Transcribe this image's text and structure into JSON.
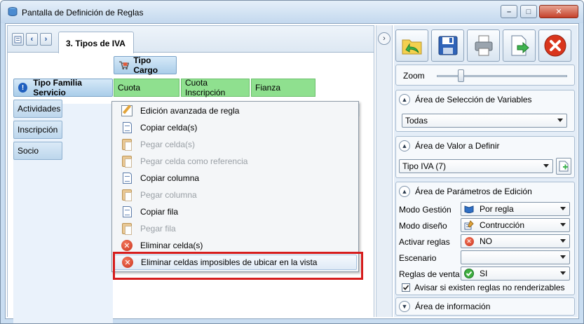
{
  "window": {
    "title": "Pantalla de Definición de Reglas",
    "controls": {
      "minimize": "–",
      "maximize": "□",
      "close": "✕"
    }
  },
  "tabs": {
    "active_label": "3. Tipos de IVA"
  },
  "grid": {
    "column_group_header": "Tipo Cargo",
    "row_group_header": "Tipo Familia Servicio",
    "columns": [
      "Cuota",
      "Cuota Inscripción",
      "Fianza"
    ],
    "rows": [
      "Actividades",
      "Inscripción",
      "Socio"
    ]
  },
  "context_menu": {
    "items": [
      {
        "label": "Edición avanzada de regla",
        "icon": "edit-icon",
        "enabled": true
      },
      {
        "label": "Copiar celda(s)",
        "icon": "copy-icon",
        "enabled": true
      },
      {
        "label": "Pegar celda(s)",
        "icon": "paste-icon",
        "enabled": false
      },
      {
        "label": "Pegar celda como referencia",
        "icon": "paste-icon",
        "enabled": false
      },
      {
        "label": "Copiar columna",
        "icon": "copy-icon",
        "enabled": true
      },
      {
        "label": "Pegar columna",
        "icon": "paste-icon",
        "enabled": false
      },
      {
        "label": "Copiar fila",
        "icon": "copy-icon",
        "enabled": true
      },
      {
        "label": "Pegar fila",
        "icon": "paste-icon",
        "enabled": false
      },
      {
        "label": "Eliminar celda(s)",
        "icon": "delete-icon",
        "enabled": true
      },
      {
        "label": "Eliminar celdas imposibles de ubicar en la vista",
        "icon": "delete-icon",
        "enabled": true,
        "highlighted": true
      }
    ]
  },
  "toolbar": {
    "buttons": [
      "open-folder-icon",
      "save-icon",
      "print-icon",
      "export-icon",
      "close-red-icon"
    ]
  },
  "zoom": {
    "label": "Zoom",
    "level": 0.19
  },
  "variables_section": {
    "title": "Área de Selección de Variables",
    "value": "Todas"
  },
  "value_section": {
    "title": "Área de Valor a Definir",
    "value": "Tipo IVA (7)"
  },
  "params_section": {
    "title": "Área de Parámetros de Edición",
    "rows": [
      {
        "label": "Modo Gestión",
        "value": "Por regla",
        "icon": "book-icon"
      },
      {
        "label": "Modo diseño",
        "value": "Contrucción",
        "icon": "design-icon"
      },
      {
        "label": "Activar reglas",
        "value": "NO",
        "icon": "no-icon"
      },
      {
        "label": "Escenario",
        "value": "",
        "icon": ""
      },
      {
        "label": "Reglas de venta",
        "value": "SI",
        "icon": "yes-icon"
      }
    ],
    "checkbox_label": "Avisar si existen reglas no renderizables",
    "checkbox_checked": true
  },
  "info_section": {
    "title": "Área de información"
  },
  "colors": {
    "green_cell": "#8fe08f",
    "highlight_border": "#d61d1d",
    "header_blue": "#aacde9"
  }
}
